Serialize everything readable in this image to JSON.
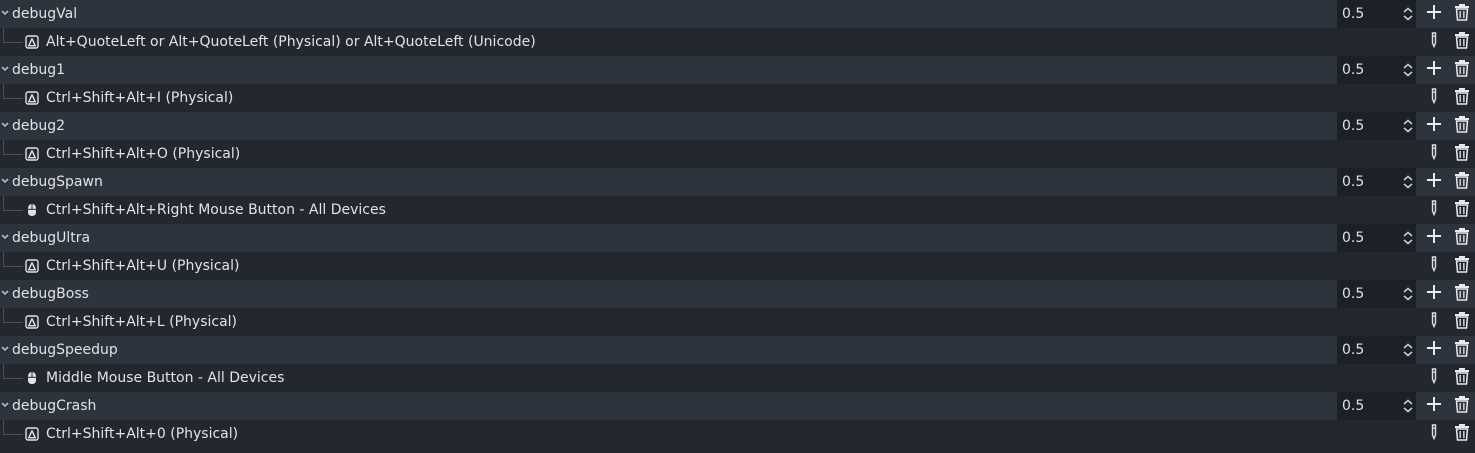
{
  "colors": {
    "background": "#232830",
    "action_row": "#2e343d",
    "deadzone_field": "#1c2027",
    "text": "#e0e3e8",
    "icon": "#dfe2e6"
  },
  "actions": [
    {
      "name": "debugVal",
      "deadzone": "0.5",
      "event": {
        "device": "keyboard-icon",
        "label": "Alt+QuoteLeft or Alt+QuoteLeft (Physical) or Alt+QuoteLeft (Unicode)"
      }
    },
    {
      "name": "debug1",
      "deadzone": "0.5",
      "event": {
        "device": "keyboard-icon",
        "label": "Ctrl+Shift+Alt+I (Physical)"
      }
    },
    {
      "name": "debug2",
      "deadzone": "0.5",
      "event": {
        "device": "keyboard-icon",
        "label": "Ctrl+Shift+Alt+O (Physical)"
      }
    },
    {
      "name": "debugSpawn",
      "deadzone": "0.5",
      "event": {
        "device": "mouse-icon",
        "label": "Ctrl+Shift+Alt+Right Mouse Button - All Devices"
      }
    },
    {
      "name": "debugUltra",
      "deadzone": "0.5",
      "event": {
        "device": "keyboard-icon",
        "label": "Ctrl+Shift+Alt+U (Physical)"
      }
    },
    {
      "name": "debugBoss",
      "deadzone": "0.5",
      "event": {
        "device": "keyboard-icon",
        "label": "Ctrl+Shift+Alt+L (Physical)"
      }
    },
    {
      "name": "debugSpeedup",
      "deadzone": "0.5",
      "event": {
        "device": "mouse-icon",
        "label": "Middle Mouse Button - All Devices"
      }
    },
    {
      "name": "debugCrash",
      "deadzone": "0.5",
      "event": {
        "device": "keyboard-icon",
        "label": "Ctrl+Shift+Alt+0 (Physical)"
      }
    }
  ]
}
